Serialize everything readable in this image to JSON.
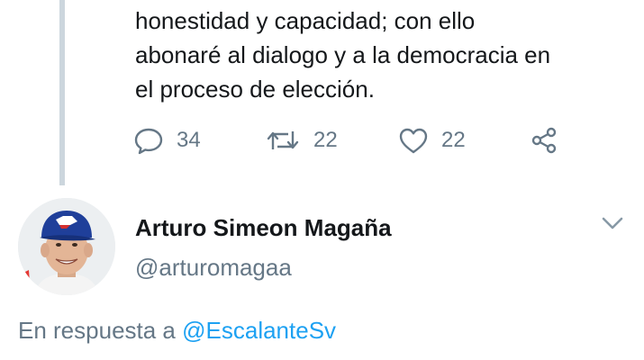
{
  "tweet": {
    "text_lines": [
      "honestidad y capacidad; con ello",
      "abonaré al dialogo y a la democracia en",
      "el proceso de elección."
    ],
    "actions": {
      "reply_count": "34",
      "retweet_count": "22",
      "like_count": "22"
    }
  },
  "next_tweet": {
    "author_name": "Arturo Simeon Magaña",
    "handle": "@arturomagaa",
    "reply_prefix": "En respuesta a",
    "reply_to_handle": "@EscalanteSv"
  },
  "colors": {
    "text": "#14171a",
    "secondary": "#657786",
    "link": "#1da1f2",
    "thread_line": "#ccd6dd"
  },
  "icons": [
    "reply-icon",
    "retweet-icon",
    "like-icon",
    "share-icon",
    "chevron-down-icon"
  ]
}
